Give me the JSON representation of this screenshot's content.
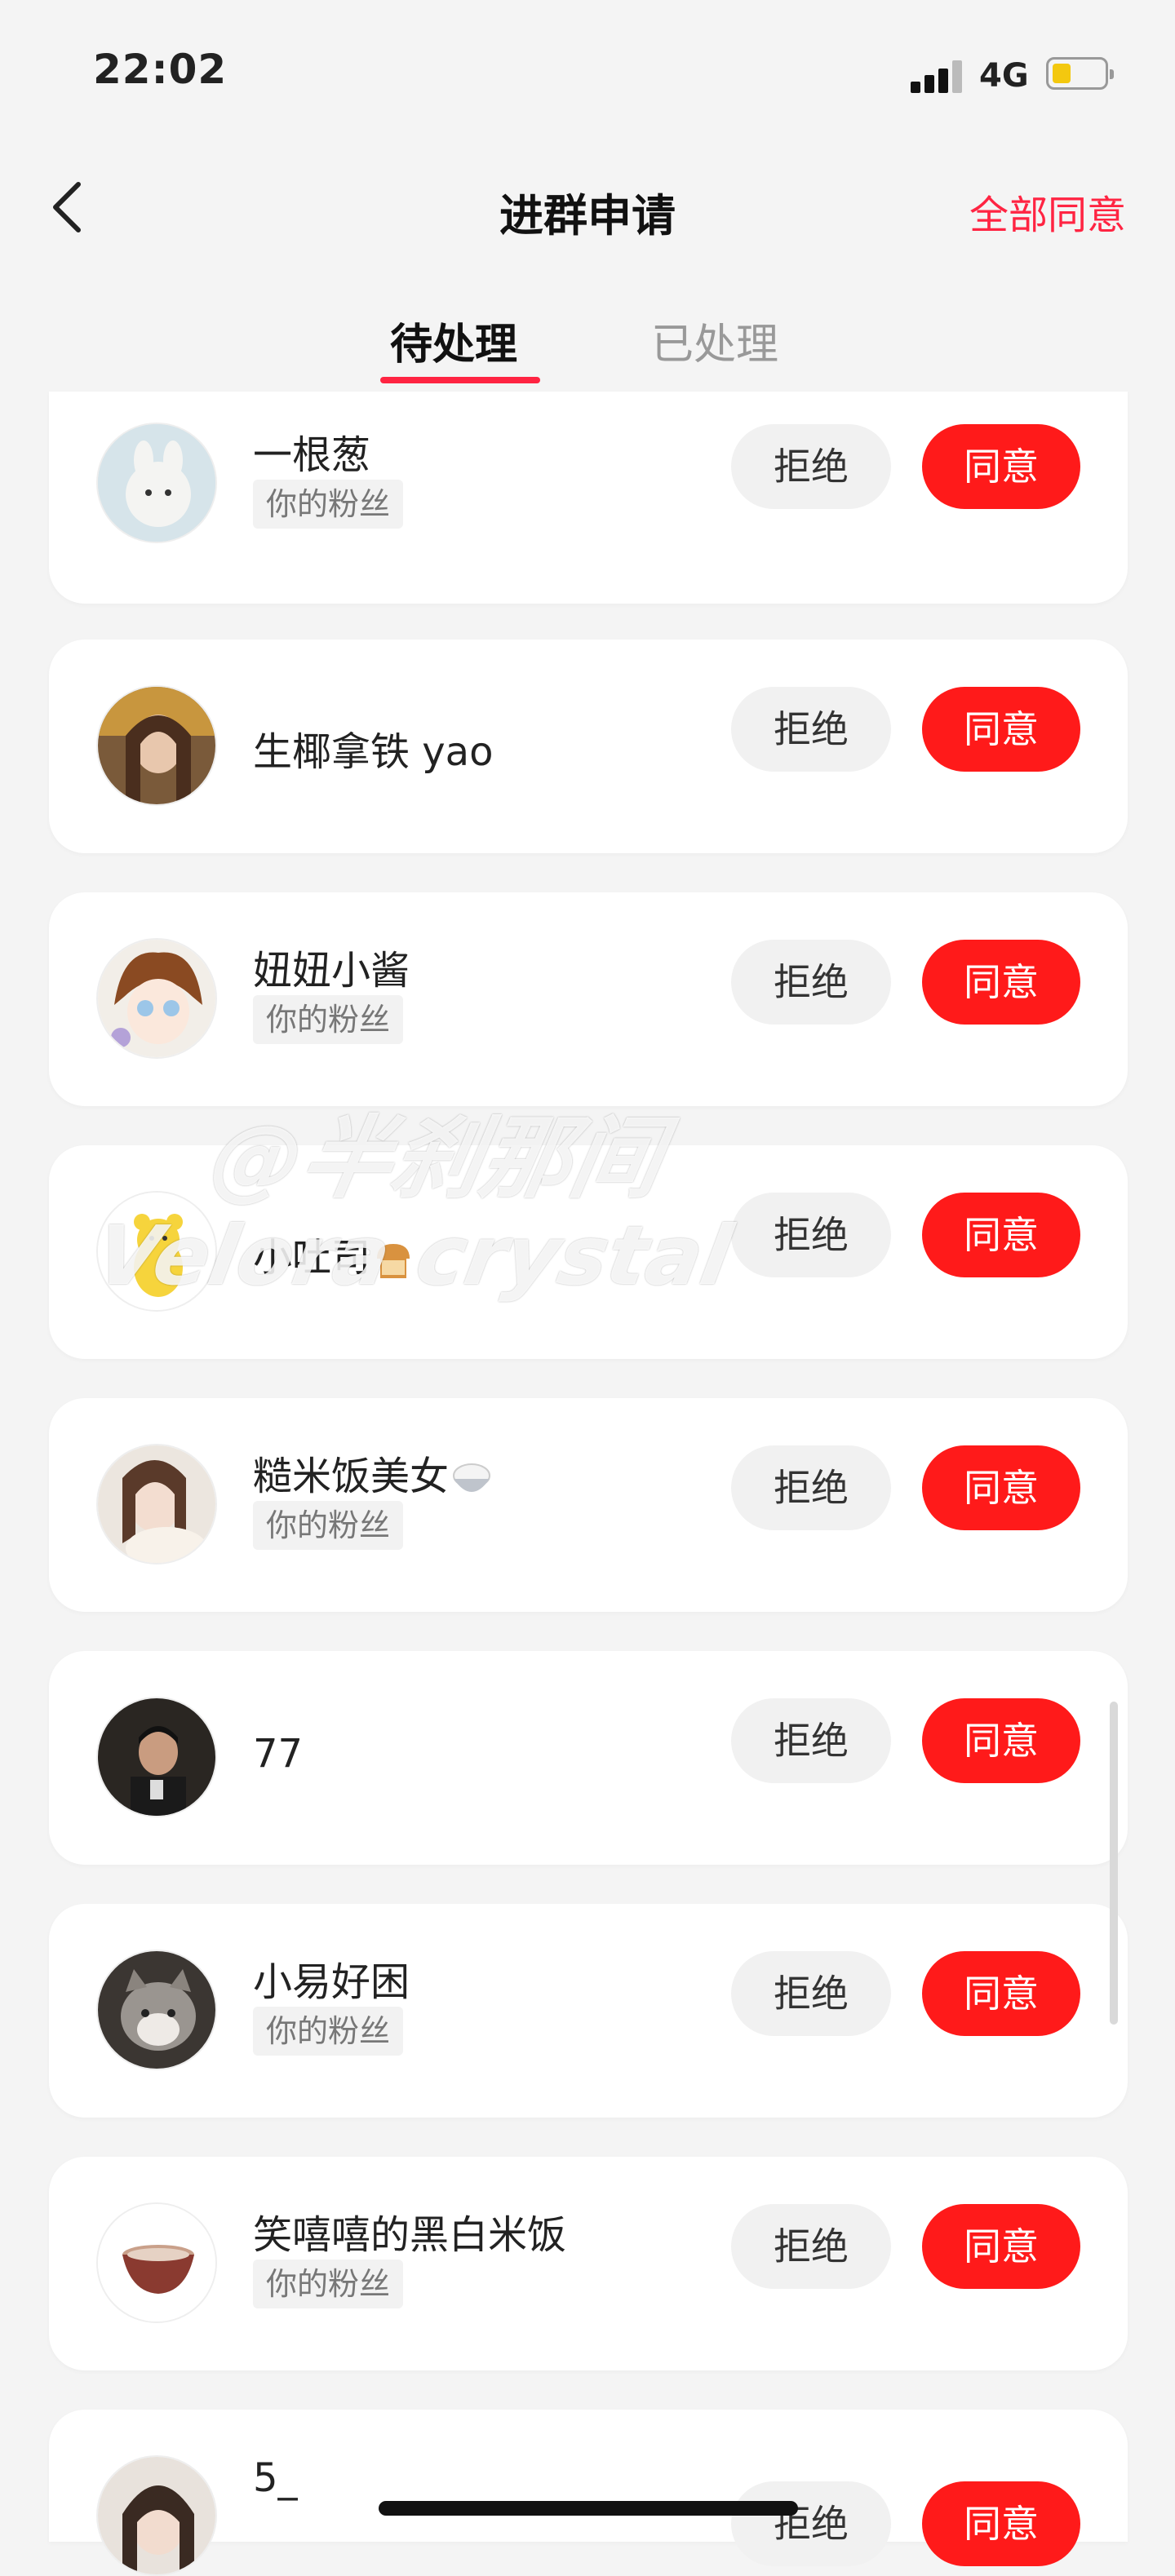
{
  "status": {
    "time": "22:02",
    "network": "4G"
  },
  "nav": {
    "title": "进群申请",
    "agree_all": "全部同意"
  },
  "tabs": [
    {
      "label": "待处理"
    },
    {
      "label": "已处理"
    }
  ],
  "buttons": {
    "reject": "拒绝",
    "accept": "同意"
  },
  "requests": [
    {
      "name": "一根葱",
      "badge": "你的粉丝"
    },
    {
      "name": "生椰拿铁 yao",
      "badge": ""
    },
    {
      "name": "妞妞小酱",
      "badge": "你的粉丝"
    },
    {
      "name": "小吐司",
      "badge": ""
    },
    {
      "name": "糙米饭美女",
      "badge": "你的粉丝"
    },
    {
      "name": "77",
      "badge": ""
    },
    {
      "name": "小易好困",
      "badge": "你的粉丝"
    },
    {
      "name": "笑嘻嘻的黑白米饭",
      "badge": "你的粉丝"
    },
    {
      "name": "5_",
      "badge": ""
    }
  ],
  "watermark": {
    "line1": "@半刹那间",
    "line2": "Velora crystal"
  },
  "colors": {
    "accent": "#ff2442",
    "accept": "#ff1a1a"
  }
}
